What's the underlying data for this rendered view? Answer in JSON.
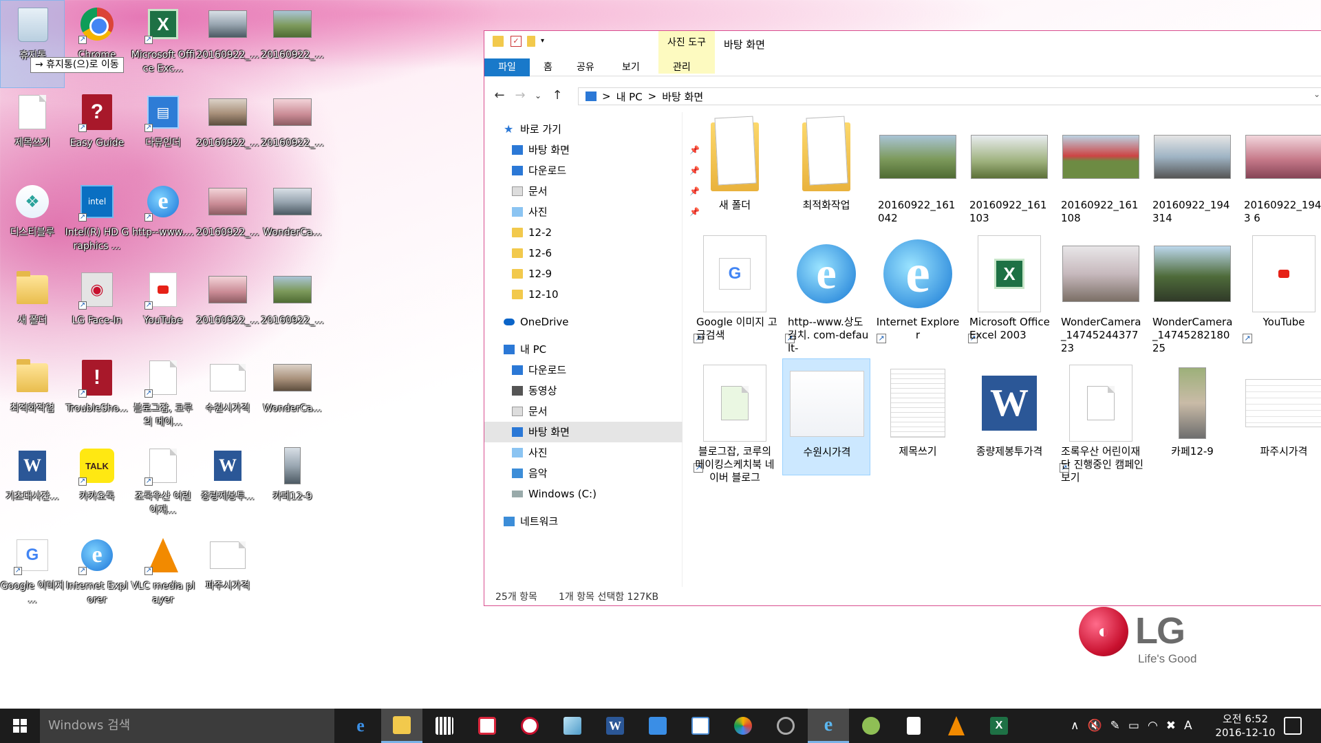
{
  "desktop": {
    "icons": [
      {
        "label": "휴지통"
      },
      {
        "label": "Chrome"
      },
      {
        "label": "Microsoft Office Exc..."
      },
      {
        "label": "20160922_..."
      },
      {
        "label": "20160922_..."
      },
      {
        "label": "제목쓰기"
      },
      {
        "label": "Easy Guide"
      },
      {
        "label": "다뮤인더"
      },
      {
        "label": "20160922_..."
      },
      {
        "label": "20160922_..."
      },
      {
        "label": "디스티블루"
      },
      {
        "label": "Intel(R) HD Graphics ..."
      },
      {
        "label": "http--www...."
      },
      {
        "label": "20160922_..."
      },
      {
        "label": "WonderCa..."
      },
      {
        "label": "새 폴더"
      },
      {
        "label": "LG Face-In"
      },
      {
        "label": "YouTube"
      },
      {
        "label": "20160922_..."
      },
      {
        "label": "20160922_..."
      },
      {
        "label": "최적화작업"
      },
      {
        "label": "TroubleSho..."
      },
      {
        "label": "블로그잡, 코루의 메이..."
      },
      {
        "label": "수원시가격"
      },
      {
        "label": "WonderCa..."
      },
      {
        "label": "기초대사잔..."
      },
      {
        "label": "카카오톡"
      },
      {
        "label": "조록우산 어린이재..."
      },
      {
        "label": "종량제봉투..."
      },
      {
        "label": "카페12-9"
      },
      {
        "label": "Google 이미지 ..."
      },
      {
        "label": "Internet Explorer"
      },
      {
        "label": "VLC media player"
      },
      {
        "label": "파주시가격"
      }
    ],
    "tooltip": "→ 휴지통(으)로 이동"
  },
  "explorer": {
    "context_tab": "사진 도구",
    "window_title": "바탕 화면",
    "tabs": {
      "file": "파일",
      "home": "홈",
      "share": "공유",
      "view": "보기",
      "manage": "관리"
    },
    "address": {
      "root": "내 PC",
      "current": "바탕 화면",
      "sep": ">"
    },
    "nav": {
      "quick_access": "바로 가기",
      "qa_items": [
        "바탕 화면",
        "다운로드",
        "문서",
        "사진",
        "12-2",
        "12-6",
        "12-9",
        "12-10"
      ],
      "onedrive": "OneDrive",
      "this_pc": "내 PC",
      "pc_items": [
        "다운로드",
        "동영상",
        "문서",
        "바탕 화면",
        "사진",
        "음악",
        "Windows (C:)"
      ],
      "network": "네트워크"
    },
    "files": [
      {
        "label": "새 폴더"
      },
      {
        "label": "최적화작업"
      },
      {
        "label": "20160922_161042"
      },
      {
        "label": "20160922_161103"
      },
      {
        "label": "20160922_161108"
      },
      {
        "label": "20160922_194314"
      },
      {
        "label": "20160922_1943 6"
      },
      {
        "label": "Google 이미지 고급검색"
      },
      {
        "label": "http--www.상도김치. com-default-"
      },
      {
        "label": "Internet Explorer"
      },
      {
        "label": "Microsoft Office Excel 2003"
      },
      {
        "label": "WonderCamera_1474524437723"
      },
      {
        "label": "WonderCamera_1474528218025"
      },
      {
        "label": "YouTube"
      },
      {
        "label": "블로그잡, 코루의 메이킹스케치북 네이버 블로그"
      },
      {
        "label": "수원시가격"
      },
      {
        "label": "제목쓰기"
      },
      {
        "label": "종량제봉투가격"
      },
      {
        "label": "조록우산 어린이재단 진행중인 캠페인 보기"
      },
      {
        "label": "카페12-9"
      },
      {
        "label": "파주시가격"
      }
    ],
    "status": {
      "count": "25개 항목",
      "selected": "1개 항목 선택함 127KB"
    }
  },
  "brand": {
    "logo": "LG",
    "tagline": "Life's Good"
  },
  "taskbar": {
    "search_placeholder": "Windows 검색",
    "time": "오전 6:52",
    "date": "2016-12-10",
    "ime": "A"
  },
  "colors": {
    "accent": "#1979ca",
    "explorer_border": "#d84d8e",
    "selection": "#cce8ff",
    "context_tab": "#fdfac0",
    "taskbar": "#1c1c1c"
  }
}
